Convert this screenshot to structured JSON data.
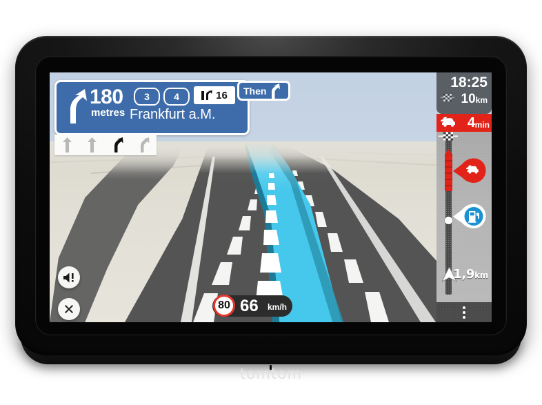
{
  "device": {
    "brand": "tomtom"
  },
  "instruction": {
    "distance_value": "180",
    "distance_unit": "metres",
    "turn_icon": "turn-right-merge-arrow-icon",
    "road_shields": [
      "3",
      "4"
    ],
    "exit_badge": {
      "icon": "motorway-exit-icon",
      "number": "16"
    },
    "street_name": "Frankfurt a.M.",
    "then": {
      "label": "Then",
      "icon": "bear-right-arrow-icon"
    }
  },
  "lane_guidance": {
    "lanes": [
      {
        "icon": "lane-straight-icon",
        "active": false
      },
      {
        "icon": "lane-straight-icon",
        "active": false
      },
      {
        "icon": "lane-bear-right-icon",
        "active": true
      },
      {
        "icon": "lane-bear-right-icon",
        "active": false
      }
    ]
  },
  "map_controls": {
    "sound_button_icon": "sound-alert-icon",
    "close_button_icon": "close-icon"
  },
  "speed": {
    "speed_limit": "80",
    "current_speed": "66",
    "unit": "km/h"
  },
  "sidebar": {
    "eta": {
      "arrival_time": "18:25",
      "distance_value": "10",
      "distance_unit": "km",
      "flag_icon": "checkered-flag-icon"
    },
    "delay": {
      "icon": "traffic-jam-car-icon",
      "value": "4",
      "unit": "min",
      "color": "#e2231a"
    },
    "route_bar": {
      "destination_icon": "checkered-flag-icon",
      "traffic_incident": {
        "icon": "traffic-jam-car-icon",
        "color": "#e2231a"
      },
      "poi_marker": {
        "icon": "fuel-station-icon",
        "color": "#1a91d0"
      },
      "position_icon": "position-arrow-icon",
      "remaining_distance_value": "1,9",
      "remaining_distance_unit": "km"
    },
    "menu_button_icon": "more-options-icon"
  },
  "colors": {
    "sign_blue": "#3e6cab",
    "route_cyan": "#46c8ec",
    "traffic_red": "#e2231a",
    "poi_blue": "#1a91d0",
    "sky": "#c2d1e3",
    "terrain": "#e2e0d6",
    "asphalt": "#545454"
  }
}
